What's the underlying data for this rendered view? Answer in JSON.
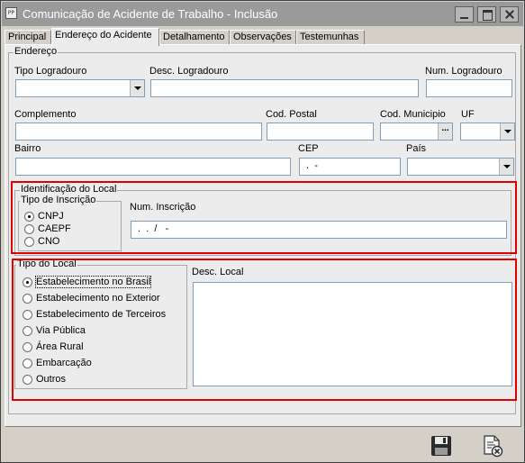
{
  "window": {
    "app_icon": "PP",
    "title": "Comunicação de Acidente de Trabalho - Inclusão",
    "icons": {
      "minimize": "minimize-icon",
      "maximize": "maximize-icon",
      "close": "close-icon"
    }
  },
  "tabs": [
    "Principal",
    "Endereço do Acidente",
    "Detalhamento",
    "Observações",
    "Testemunhas"
  ],
  "active_tab": "Endereço do Acidente",
  "endereco": {
    "legend": "Endereço",
    "tipo_logradouro_label": "Tipo Logradouro",
    "tipo_logradouro_value": "",
    "desc_logradouro_label": "Desc. Logradouro",
    "desc_logradouro_value": "",
    "num_logradouro_label": "Num. Logradouro",
    "num_logradouro_value": "",
    "complemento_label": "Complemento",
    "complemento_value": "",
    "cod_postal_label": "Cod. Postal",
    "cod_postal_value": "",
    "cod_municipio_label": "Cod. Municipio",
    "cod_municipio_value": "",
    "cod_municipio_button": "...",
    "uf_label": "UF",
    "uf_value": "",
    "bairro_label": "Bairro",
    "bairro_value": "",
    "cep_label": "CEP",
    "cep_value": " .  -",
    "pais_label": "País",
    "pais_value": ""
  },
  "identificacao": {
    "legend": "Identificação do Local",
    "tipo_inscricao_legend": "Tipo de Inscrição",
    "options": [
      "CNPJ",
      "CAEPF",
      "CNO"
    ],
    "selected": "CNPJ",
    "num_inscricao_label": "Num. Inscrição",
    "num_inscricao_value": " .  .  /   -"
  },
  "tipo_local": {
    "legend": "Tipo do Local",
    "options": [
      "Estabelecimento no Brasil",
      "Estabelecimento no Exterior",
      "Estabelecimento de Terceiros",
      "Via Pública",
      "Área Rural",
      "Embarcação",
      "Outros"
    ],
    "selected": "Estabelecimento no Brasil",
    "desc_local_label": "Desc. Local",
    "desc_local_value": ""
  },
  "toolbar": {
    "save_icon": "save-icon",
    "cancel_icon": "cancel-document-icon"
  },
  "colors": {
    "highlight": "#e00000",
    "titlebar": "#9a9a9a",
    "panel": "#ececec"
  }
}
